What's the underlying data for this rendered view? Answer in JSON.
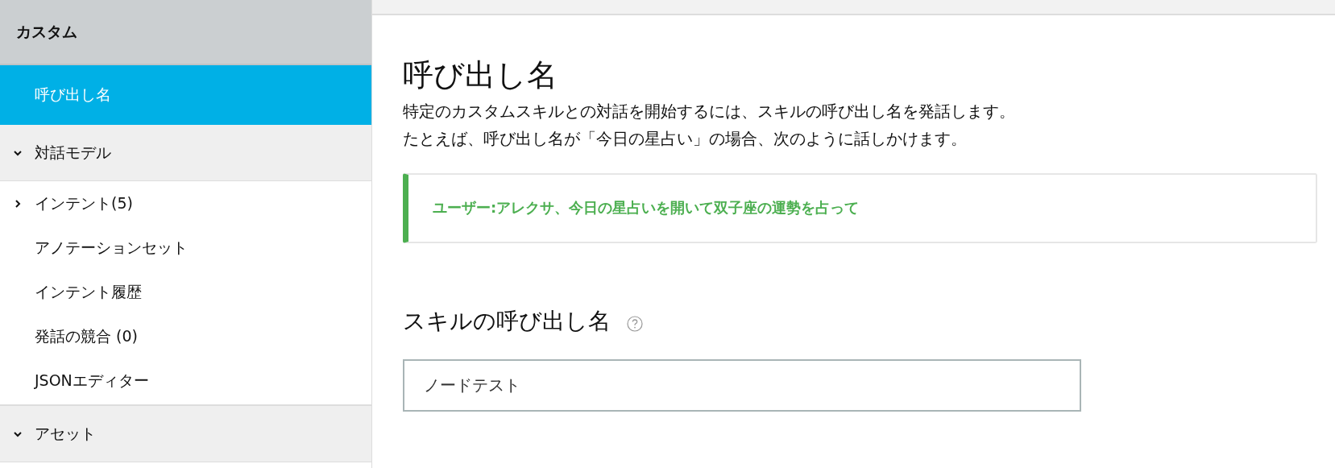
{
  "sidebar": {
    "header": "カスタム",
    "items": [
      {
        "label": "呼び出し名",
        "selected": true
      },
      {
        "label": "対話モデル",
        "selected": false,
        "expanded": true,
        "children": [
          {
            "label": "インテント(5)",
            "selected": false,
            "expanded": false
          },
          {
            "label": "アノテーションセット",
            "selected": false
          },
          {
            "label": "インテント履歴",
            "selected": false
          },
          {
            "label": "発話の競合 (0)",
            "selected": false
          },
          {
            "label": "JSONエディター",
            "selected": false
          }
        ]
      },
      {
        "label": "アセット",
        "selected": false,
        "expanded": true
      }
    ]
  },
  "main": {
    "title": "呼び出し名",
    "description": [
      "特定のカスタムスキルとの対話を開始するには、スキルの呼び出し名を発話します。",
      "たとえば、呼び出し名が「今日の星占い」の場合、次のように話しかけます。"
    ],
    "example": "ユーザー:アレクサ、今日の星占いを開いて双子座の運勢を占って",
    "section_title": "スキルの呼び出し名",
    "invocation_field": {
      "value": "ノードテスト"
    }
  }
}
